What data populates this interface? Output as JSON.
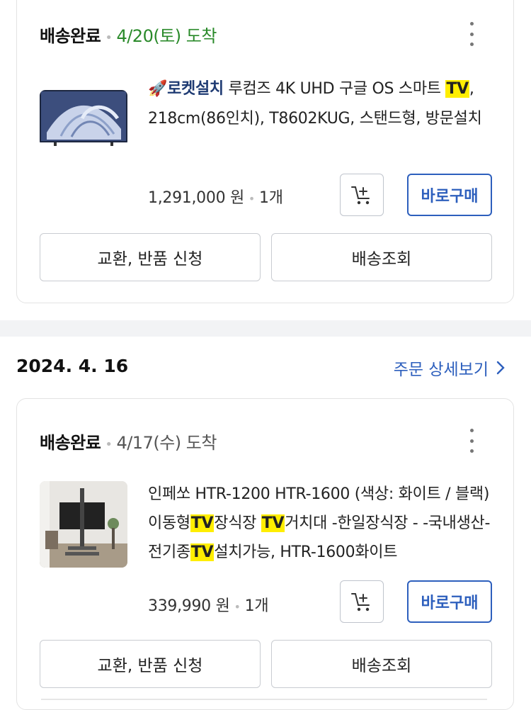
{
  "orders": [
    {
      "status": "배송완료",
      "arrival": "4/20(토) 도착",
      "product": {
        "badge": "로켓설치",
        "title_parts": [
          {
            "text": " 루컴즈 4K UHD 구글 OS 스마트 ",
            "hl": false
          },
          {
            "text": "TV",
            "hl": true
          },
          {
            "text": ", 218cm(86인치), T8602KUG, 스탠드형, 방문설치",
            "hl": false
          }
        ],
        "price": "1,291,000 원",
        "quantity": "1개",
        "image_icon": "tv-thumbnail"
      },
      "buy_label": "바로구매",
      "exchange_label": "교환, 반품 신청",
      "track_label": "배송조회"
    },
    {
      "order_date": "2024. 4. 16",
      "detail_link": "주문 상세보기",
      "status": "배송완료",
      "arrival": "4/17(수) 도착",
      "product": {
        "title_parts": [
          {
            "text": "인페쏘 HTR-1200 HTR-1600 (색상: 화이트 / 블랙) 이동형",
            "hl": false
          },
          {
            "text": "TV",
            "hl": true
          },
          {
            "text": "장식장 ",
            "hl": false
          },
          {
            "text": "TV",
            "hl": true
          },
          {
            "text": "거치대 -한일장식장 - -국내생산- 전기종",
            "hl": false
          },
          {
            "text": "TV",
            "hl": true
          },
          {
            "text": "설치가능, HTR-1600화이트",
            "hl": false
          }
        ],
        "price": "339,990 원",
        "quantity": "1개",
        "image_icon": "tv-stand-thumbnail"
      },
      "buy_label": "바로구매",
      "exchange_label": "교환, 반품 신청",
      "track_label": "배송조회"
    }
  ],
  "colors": {
    "accent": "#2d5fbd",
    "arrival_green": "#2a8a2a",
    "highlight": "#ffee00"
  }
}
